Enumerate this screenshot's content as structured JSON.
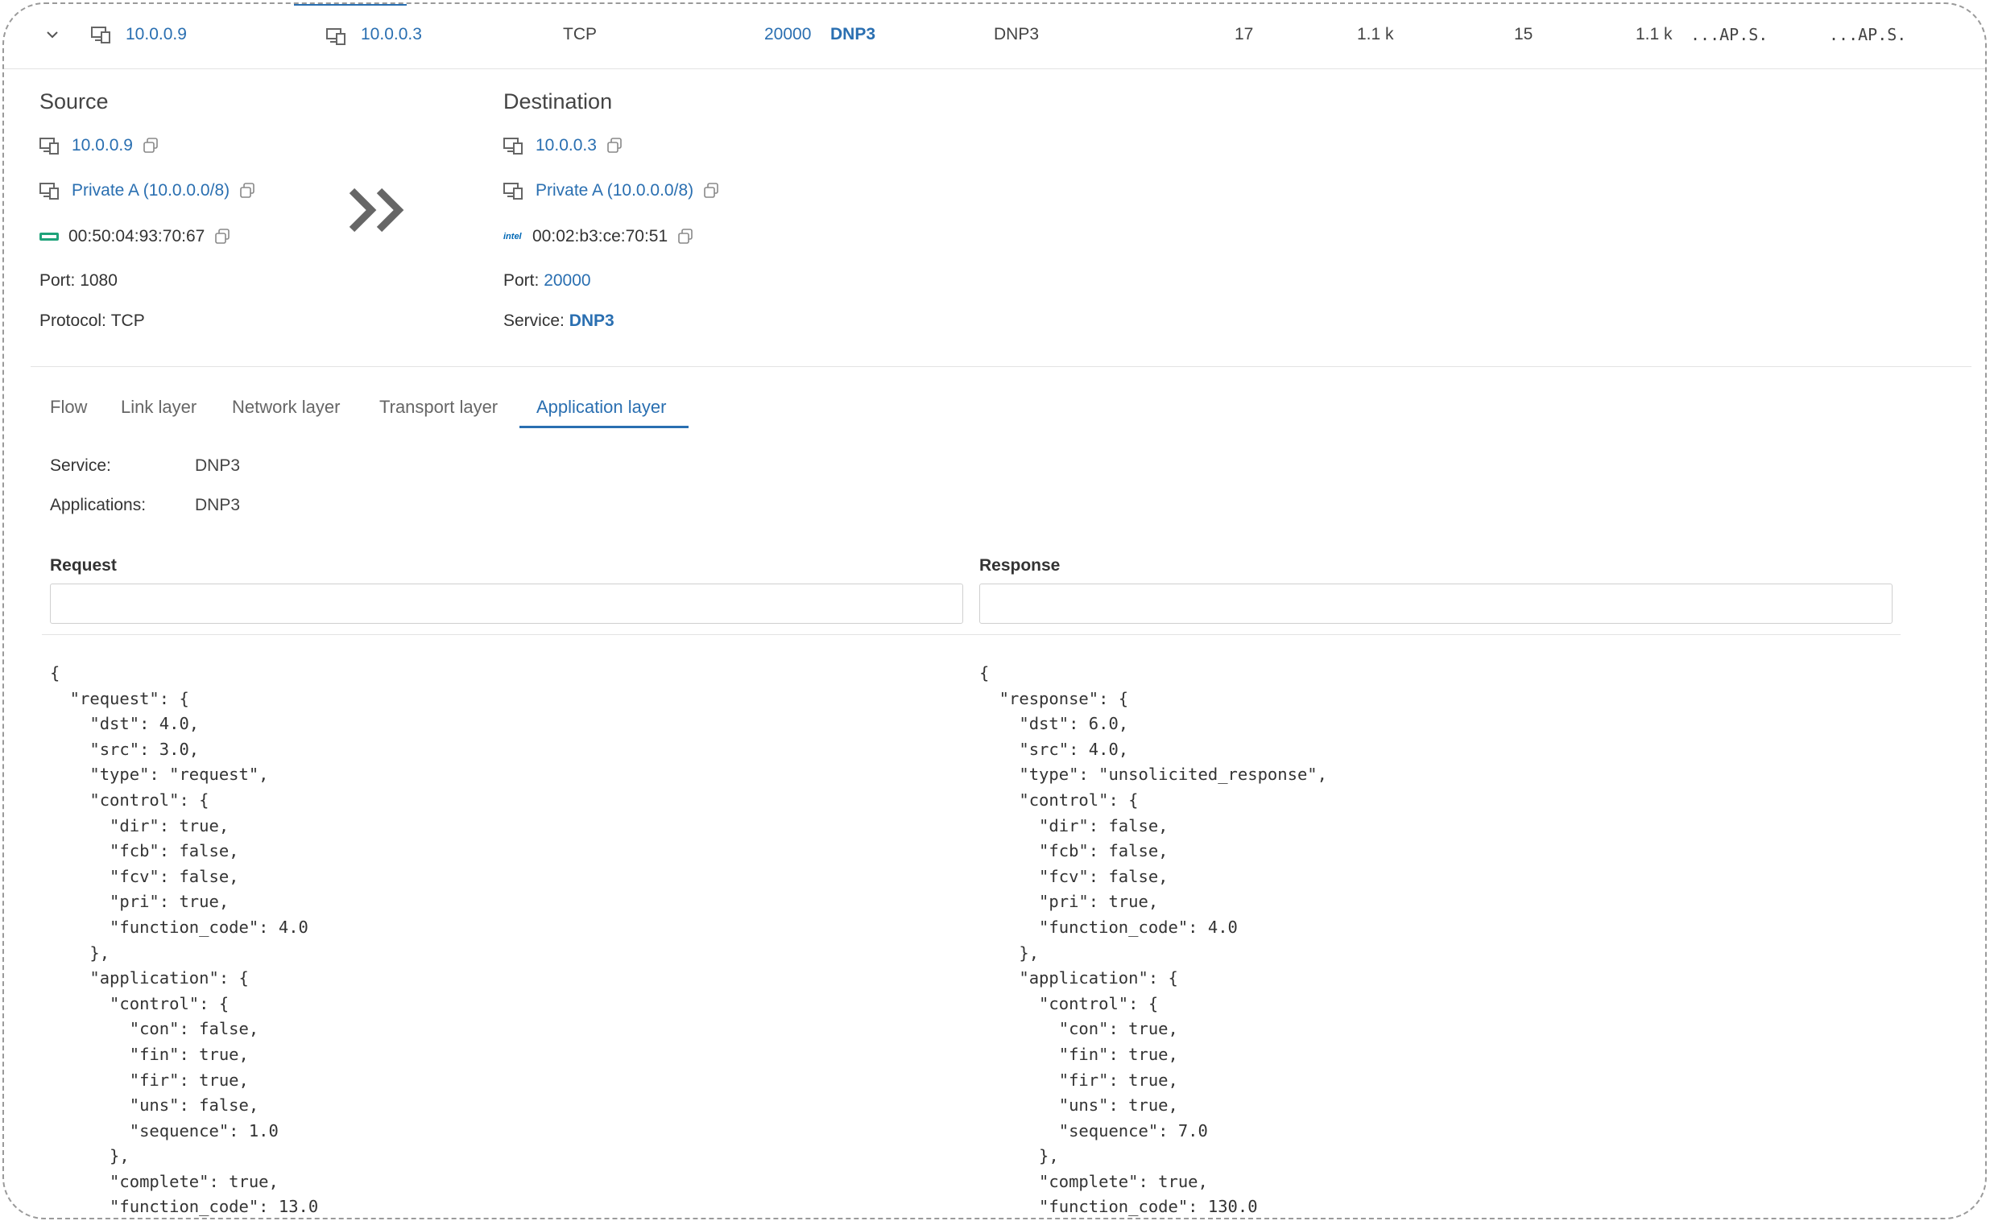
{
  "flow_row": {
    "src_ip": "10.0.0.9",
    "dst_ip": "10.0.0.3",
    "protocol": "TCP",
    "dst_port": "20000",
    "service": "DNP3",
    "application": "DNP3",
    "packets_out": "17",
    "bytes_out": "1.1 k",
    "packets_in": "15",
    "bytes_in": "1.1 k",
    "flags_out": "...AP.S.",
    "flags_in": "...AP.S."
  },
  "source": {
    "title": "Source",
    "ip": "10.0.0.9",
    "network": "Private A (10.0.0.0/8)",
    "mac": "00:50:04:93:70:67",
    "port_label": "Port:",
    "port": "1080",
    "protocol_label": "Protocol:",
    "protocol": "TCP"
  },
  "destination": {
    "title": "Destination",
    "ip": "10.0.0.3",
    "network": "Private A (10.0.0.0/8)",
    "vendor_logo": "intel",
    "mac": "00:02:b3:ce:70:51",
    "port_label": "Port:",
    "port": "20000",
    "service_label": "Service:",
    "service": "DNP3"
  },
  "tabs": [
    "Flow",
    "Link layer",
    "Network layer",
    "Transport layer",
    "Application layer"
  ],
  "active_tab": "Application layer",
  "app_layer": {
    "service_label": "Service:",
    "service": "DNP3",
    "applications_label": "Applications:",
    "applications": "DNP3"
  },
  "request": {
    "label": "Request",
    "filter_value": "",
    "json_text": "{\n  \"request\": {\n    \"dst\": 4.0,\n    \"src\": 3.0,\n    \"type\": \"request\",\n    \"control\": {\n      \"dir\": true,\n      \"fcb\": false,\n      \"fcv\": false,\n      \"pri\": true,\n      \"function_code\": 4.0\n    },\n    \"application\": {\n      \"control\": {\n        \"con\": false,\n        \"fin\": true,\n        \"fir\": true,\n        \"uns\": false,\n        \"sequence\": 1.0\n      },\n      \"complete\": true,\n      \"function_code\": 13.0"
  },
  "response": {
    "label": "Response",
    "filter_value": "",
    "json_text": "{\n  \"response\": {\n    \"dst\": 6.0,\n    \"src\": 4.0,\n    \"type\": \"unsolicited_response\",\n    \"control\": {\n      \"dir\": false,\n      \"fcb\": false,\n      \"fcv\": false,\n      \"pri\": true,\n      \"function_code\": 4.0\n    },\n    \"application\": {\n      \"control\": {\n        \"con\": true,\n        \"fin\": true,\n        \"fir\": true,\n        \"uns\": true,\n        \"sequence\": 7.0\n      },\n      \"complete\": true,\n      \"function_code\": 130.0"
  },
  "colors": {
    "link": "#2a6fb1",
    "mac_vendor_green": "#1fa37a",
    "intel_blue": "#0068b5"
  }
}
